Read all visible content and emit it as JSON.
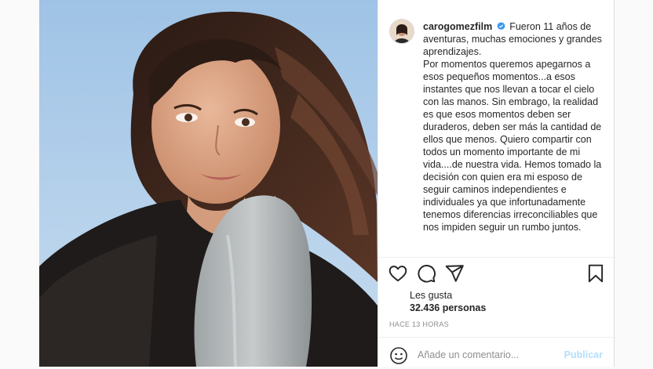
{
  "post": {
    "username": "carogomezfilm",
    "verified_icon": "verified-badge-icon",
    "caption_first": "Fueron 11 años de aventuras, muchas emociones y grandes aprendizajes.",
    "caption_rest": "Por momentos queremos apegarnos a esos pequeños momentos...a esos instantes que nos llevan a tocar el cielo con las manos. Sin embrago, la realidad es que esos momentos deben ser duraderos, deben ser más la cantidad de ellos que menos. Quiero compartir con todos un momento importante de mi vida....de nuestra vida. Hemos tomado la decisión con quien era mi esposo de seguir caminos independientes e individuales ya que infortunadamente tenemos diferencias irreconciliables que nos impiden seguir un rumbo juntos.",
    "likes_label": "Les gusta",
    "likes_count": "32.436 personas",
    "time_ago": "HACE 13 HORAS",
    "comment_placeholder": "Añade un comentario...",
    "publish_label": "Publicar"
  },
  "icons": {
    "like": "heart-icon",
    "comment": "comment-icon",
    "share": "paper-plane-icon",
    "save": "bookmark-icon",
    "emoji": "emoji-icon"
  },
  "colors": {
    "verified": "#3897f0",
    "publish_disabled": "#b2dffc",
    "muted": "#8e8e8e"
  }
}
